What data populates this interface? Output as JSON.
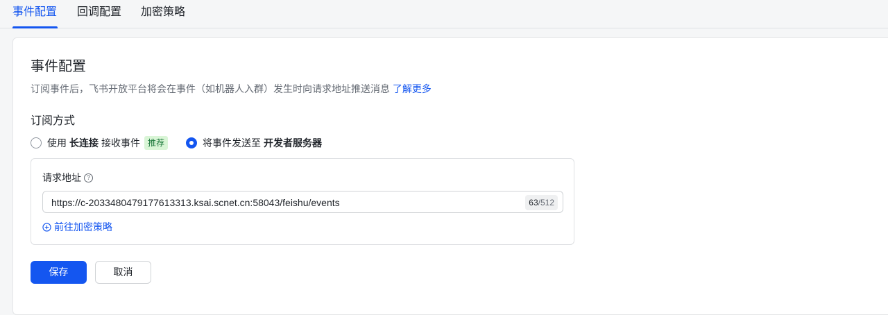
{
  "tabs": [
    {
      "label": "事件配置",
      "active": true
    },
    {
      "label": "回调配置",
      "active": false
    },
    {
      "label": "加密策略",
      "active": false
    }
  ],
  "page": {
    "title": "事件配置",
    "description": "订阅事件后，飞书开放平台将会在事件（如机器人入群）发生时向请求地址推送消息",
    "learn_more": "了解更多"
  },
  "subscription": {
    "title": "订阅方式",
    "option1": {
      "prefix": "使用",
      "bold": "长连接",
      "suffix": "接收事件",
      "tag": "推荐",
      "checked": false
    },
    "option2": {
      "prefix": "将事件发送至",
      "bold": "开发者服务器",
      "checked": true
    }
  },
  "request_url": {
    "label": "请求地址",
    "value": "https://c-2033480479177613313.ksai.scnet.cn:58043/feishu/events",
    "count": "63",
    "max": "/512",
    "encrypt_link": "前往加密策略"
  },
  "actions": {
    "save": "保存",
    "cancel": "取消"
  },
  "colors": {
    "accent": "#1456f0",
    "tag_bg": "#d9f5d6",
    "tag_text": "#1f7a3e"
  }
}
